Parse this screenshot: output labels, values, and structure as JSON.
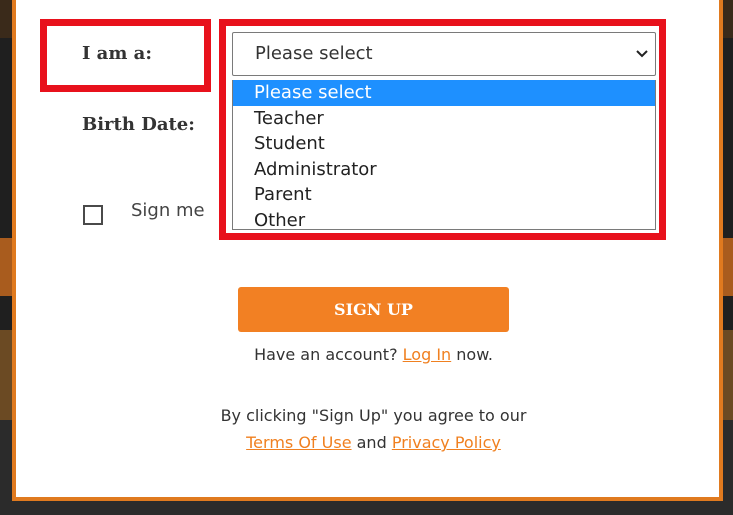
{
  "form": {
    "role_label": "I am a:",
    "birth_label": "Birth Date:",
    "role_select": {
      "selected": "Please select",
      "options": [
        "Please select",
        "Teacher",
        "Student",
        "Administrator",
        "Parent",
        "Other"
      ]
    },
    "signme_label": "Sign me"
  },
  "actions": {
    "signup_label": "SIGN UP",
    "have_account_prefix": "Have an account?",
    "login_link": "Log In",
    "have_account_suffix": "now.",
    "terms_line1": "By clicking \"Sign Up\" you agree to our",
    "terms_link": "Terms Of Use",
    "terms_and": "and",
    "privacy_link": "Privacy Policy"
  },
  "colors": {
    "accent": "#f28023",
    "highlight": "#e8111c",
    "selected_option": "#1e90ff"
  },
  "icons": {
    "select_arrow": "chevron-down-icon"
  }
}
